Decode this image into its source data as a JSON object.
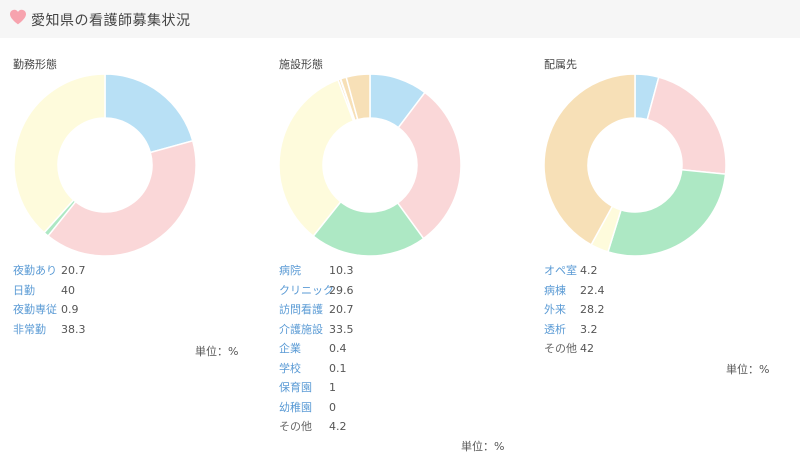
{
  "header": {
    "title": "愛知県の看護師募集状況",
    "icon": "heart-icon",
    "icon_color": "#f7a3ae"
  },
  "unit_label": "単位：%",
  "colors": [
    "#b8e0f5",
    "#fad7d8",
    "#ade8c4",
    "#fefbdc",
    "#f7e0b7"
  ],
  "chart_data": [
    {
      "type": "pie",
      "title": "勤務形態",
      "categories": [
        "夜勤あり",
        "日勤",
        "夜勤専従",
        "非常勤"
      ],
      "values": [
        20.7,
        40,
        0.9,
        38.3
      ],
      "colors": [
        "#b8e0f5",
        "#fad7d8",
        "#ade8c4",
        "#fefbdc"
      ],
      "links": [
        true,
        true,
        true,
        true
      ]
    },
    {
      "type": "pie",
      "title": "施設形態",
      "categories": [
        "病院",
        "クリニック",
        "訪問看護",
        "介護施設",
        "企業",
        "学校",
        "保育園",
        "幼稚園",
        "その他"
      ],
      "values": [
        10.3,
        29.6,
        20.7,
        33.5,
        0.4,
        0.1,
        1,
        0,
        4.2
      ],
      "colors": [
        "#b8e0f5",
        "#fad7d8",
        "#ade8c4",
        "#fefbdc",
        "#f7e0b7",
        "#f7e0b7",
        "#f7e0b7",
        "#f7e0b7",
        "#f7e0b7"
      ],
      "links": [
        true,
        true,
        true,
        true,
        true,
        true,
        true,
        true,
        false
      ]
    },
    {
      "type": "pie",
      "title": "配属先",
      "categories": [
        "オペ室",
        "病棟",
        "外来",
        "透析",
        "その他"
      ],
      "values": [
        4.2,
        22.4,
        28.2,
        3.2,
        42
      ],
      "colors": [
        "#b8e0f5",
        "#fad7d8",
        "#ade8c4",
        "#fefbdc",
        "#f7e0b7"
      ],
      "links": [
        true,
        true,
        true,
        true,
        false
      ]
    }
  ]
}
